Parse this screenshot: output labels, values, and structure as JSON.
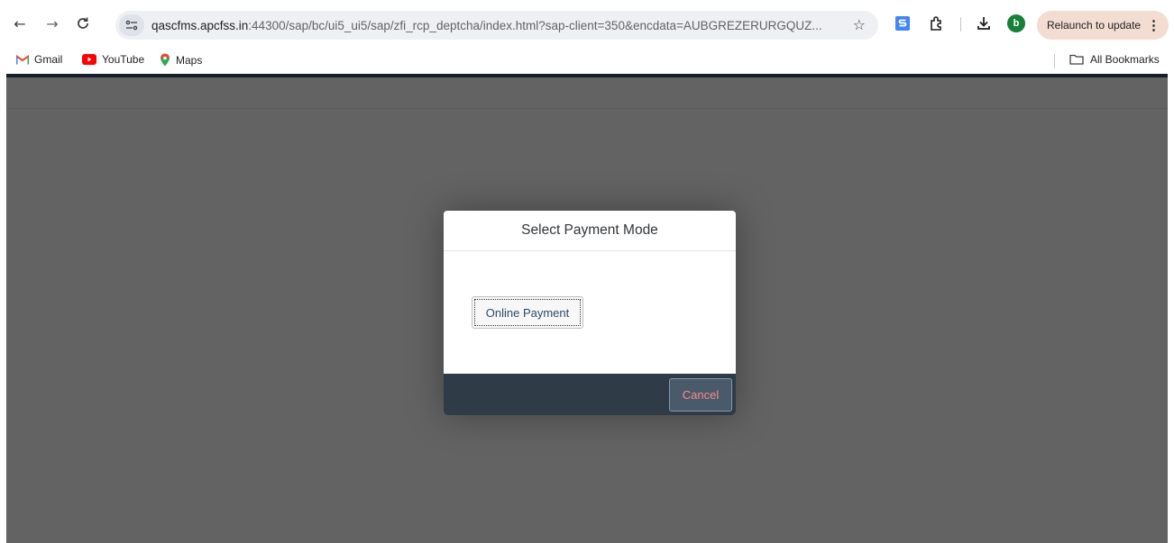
{
  "browser": {
    "url_host": "qascfms.apcfss.in",
    "url_rest": ":44300/sap/bc/ui5_ui5/sap/zfi_rcp_deptcha/index.html?sap-client=350&encdata=AUBGREZERURGQUZ...",
    "profile_initial": "b",
    "relaunch_label": "Relaunch to update",
    "bookmarks": [
      {
        "label": "Gmail",
        "icon": "gmail-icon"
      },
      {
        "label": "YouTube",
        "icon": "youtube-icon"
      },
      {
        "label": "Maps",
        "icon": "maps-icon"
      }
    ],
    "all_bookmarks_label": "All Bookmarks"
  },
  "dialog": {
    "title": "Select Payment Mode",
    "online_payment_label": "Online Payment",
    "cancel_label": "Cancel"
  },
  "colors": {
    "shell_accent": "#354a5f",
    "dialog_footer": "#2f3c48",
    "cancel_text": "#ff8888",
    "relaunch_bg": "#f3dcd2"
  }
}
